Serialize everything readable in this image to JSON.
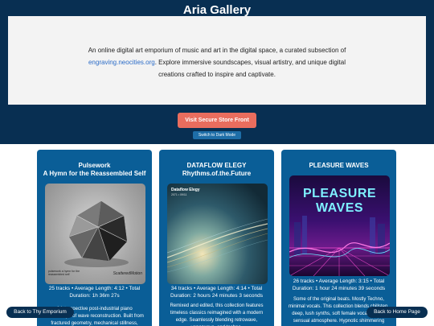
{
  "site": {
    "title": "Aria Gallery"
  },
  "intro": {
    "before_link": "An online digital art emporium of music and art in the digital space, a curated subsection of ",
    "link": "engraving.neocities.org",
    "after_link": ". Explore immersive soundscapes, visual artistry, and unique digital creations crafted to inspire and captivate."
  },
  "buttons": {
    "store": "Visit Secure Store Front",
    "dark_mode": "Switch to Dark Mode",
    "back_emporium": "Back to Thy Emporium",
    "back_home": "Back to Home Page"
  },
  "cards": [
    {
      "title_line1": "Pulsework",
      "title_line2": "A Hymn for the Reassembled Self",
      "art_caption_left": "pulsework a hymn for the reassembled self",
      "art_caption_right": "ScatteredMotion",
      "stats": "25 tracks • Average Length: 4:12 • Total Duration: 1h 36m 27s",
      "description": "A introspective post-industrial piano soundscape of wave reconstruction. Built from fractured geometry, mechanical stillness,"
    },
    {
      "title_line1": "DATAFLOW ELEGY",
      "title_line2": "Rhythms.of.the.Future",
      "art_caption_top": "Dataflow Elegy",
      "art_caption_sub": "2071 • 09/11",
      "stats": "34 tracks • Average Length: 4:14 • Total Duration: 2 hours 24 minutes 3 seconds",
      "description": "Remixed and edited, this collection features timeless classics reimagined with a modern edge. Seamlessly blending retrowave, vaporwave, and techno,"
    },
    {
      "title_line1": "PLEASURE WAVES",
      "title_line2": "",
      "art_word1": "PLEASURE",
      "art_word2": "WAVES",
      "stats": "26 tracks • Average Length: 3:15 • Total Duration: 1 hour 24 minutes 39 seconds",
      "description": "Some of the original beats. Mostly Techno, minimal vocals. This collection blends chillstep, deep, lush synths, soft female vocals, and a sensual atmosphere. Hypnotic shimmering"
    }
  ],
  "colors": {
    "header": "#082f52",
    "card": "#0a5e97",
    "accent_button": "#e96d5e",
    "link": "#2a6bc7"
  }
}
